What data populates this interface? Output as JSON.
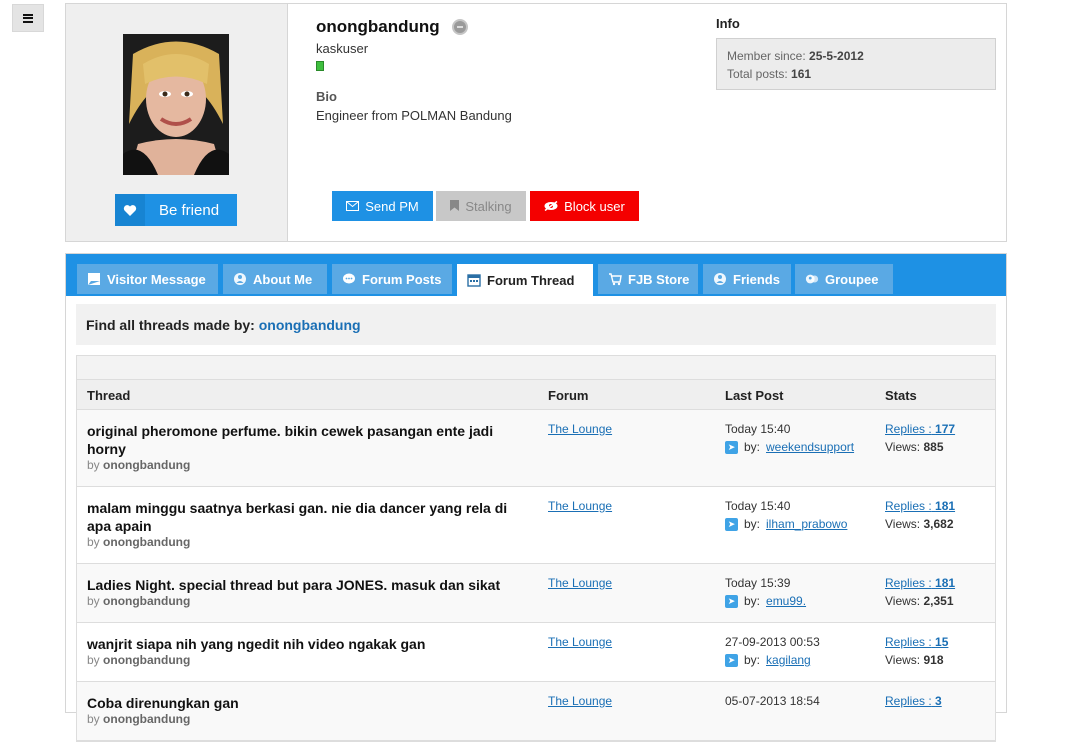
{
  "menu": {
    "icon": "hamburger-icon"
  },
  "profile": {
    "username": "onongbandung",
    "usertitle": "kaskuser",
    "bio_heading": "Bio",
    "bio_text": "Engineer from POLMAN Bandung",
    "info_heading": "Info",
    "member_since_label": "Member since:",
    "member_since_value": "25-5-2012",
    "total_posts_label": "Total posts:",
    "total_posts_value": "161",
    "friend_button": "Be friend",
    "send_pm": "Send PM",
    "stalking": "Stalking",
    "block_user": "Block user"
  },
  "tabs": [
    {
      "label": "Visitor Message",
      "icon": "message-icon"
    },
    {
      "label": "About Me",
      "icon": "user-icon"
    },
    {
      "label": "Forum Posts",
      "icon": "chat-icon"
    },
    {
      "label": "Forum Thread",
      "icon": "calendar-icon",
      "active": true
    },
    {
      "label": "FJB Store",
      "icon": "cart-icon"
    },
    {
      "label": "Friends",
      "icon": "user-icon"
    },
    {
      "label": "Groupee",
      "icon": "group-icon"
    }
  ],
  "find": {
    "label": "Find all threads made by:",
    "user": "onongbandung"
  },
  "table": {
    "headers": {
      "thread": "Thread",
      "forum": "Forum",
      "last_post": "Last Post",
      "stats": "Stats"
    },
    "by_prefix": "by",
    "lp_by_prefix": "by:",
    "replies_prefix": "Replies :",
    "views_prefix": "Views:",
    "rows": [
      {
        "title": "original pheromone perfume. bikin cewek pasangan ente jadi horny",
        "author": "onongbandung",
        "forum": "The Lounge",
        "last_post_time": "Today 15:40",
        "last_post_user": "weekendsupport",
        "replies": "177",
        "views": "885"
      },
      {
        "title": "malam minggu saatnya berkasi gan. nie dia dancer yang rela di apa apain",
        "author": "onongbandung",
        "forum": "The Lounge",
        "last_post_time": "Today 15:40",
        "last_post_user": "ilham_prabowo",
        "replies": "181",
        "views": "3,682"
      },
      {
        "title": "Ladies Night. special thread but para JONES. masuk dan sikat",
        "author": "onongbandung",
        "forum": "The Lounge",
        "last_post_time": "Today 15:39",
        "last_post_user": "emu99.",
        "replies": "181",
        "views": "2,351"
      },
      {
        "title": "wanjrit siapa nih yang ngedit nih video ngakak gan",
        "author": "onongbandung",
        "forum": "The Lounge",
        "last_post_time": "27-09-2013 00:53",
        "last_post_user": "kagilang",
        "replies": "15",
        "views": "918"
      },
      {
        "title": "Coba direnungkan gan",
        "author": "onongbandung",
        "forum": "The Lounge",
        "last_post_time": "05-07-2013 18:54",
        "last_post_user": "",
        "replies": "3",
        "views": ""
      }
    ]
  }
}
